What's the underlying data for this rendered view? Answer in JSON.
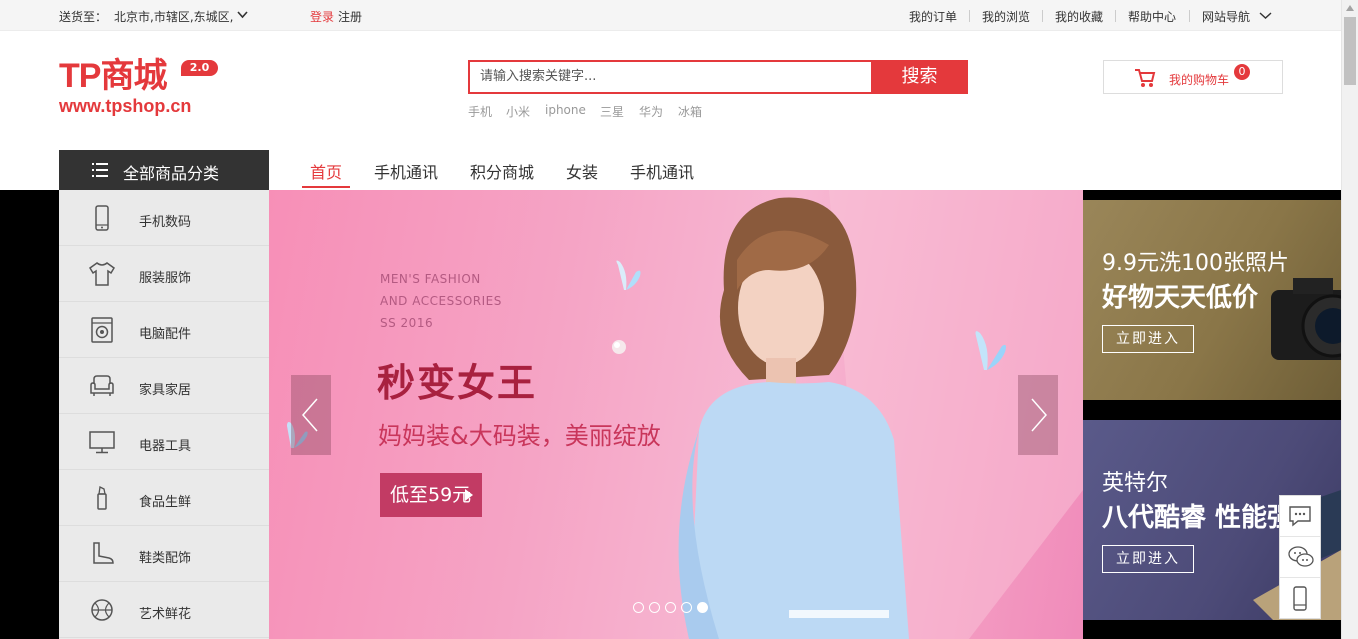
{
  "topbar": {
    "delivery_label": "送货至：",
    "location": "北京市,市辖区,东城区,",
    "login": "登录",
    "register": "注册",
    "links": [
      "我的订单",
      "我的浏览",
      "我的收藏",
      "帮助中心",
      "网站导航"
    ]
  },
  "header": {
    "logo_text": "TP商城",
    "logo_version": "2.0",
    "logo_url": "www.tpshop.cn",
    "search_placeholder": "请输入搜索关键字...",
    "search_button": "搜索",
    "hot_words": [
      "手机",
      "小米",
      "iphone",
      "三星",
      "华为",
      "冰箱"
    ],
    "cart_label": "我的购物车",
    "cart_count": "0"
  },
  "nav": {
    "all_categories": "全部商品分类",
    "items": [
      "首页",
      "手机通讯",
      "积分商城",
      "女装",
      "手机通讯"
    ],
    "active_index": 0
  },
  "categories": [
    {
      "label": "手机数码",
      "icon": "phone-icon"
    },
    {
      "label": "服装服饰",
      "icon": "shirt-icon"
    },
    {
      "label": "电脑配件",
      "icon": "washer-icon"
    },
    {
      "label": "家具家居",
      "icon": "sofa-icon"
    },
    {
      "label": "电器工具",
      "icon": "monitor-icon"
    },
    {
      "label": "食品生鲜",
      "icon": "lipstick-icon"
    },
    {
      "label": "鞋类配饰",
      "icon": "boot-icon"
    },
    {
      "label": "艺术鲜花",
      "icon": "ball-icon"
    }
  ],
  "slide": {
    "en_lines": [
      "MEN'S FASHION",
      "AND ACCESSORIES",
      "SS 2016"
    ],
    "title": "秒变女王",
    "subtitle": "妈妈装&大码装，美丽绽放",
    "cta": "低至59元",
    "dot_count": 5,
    "active_dot": 4
  },
  "ads": [
    {
      "line1": "9.9元洗100张照片",
      "line2": "好物天天低价",
      "button": "立即进入",
      "color": "#8a7648"
    },
    {
      "line1": "英特尔",
      "line2": "八代酷睿 性能强劲",
      "button": "立即进入",
      "color": "#4d4b78"
    }
  ],
  "colors": {
    "brand": "#e4393c",
    "cta": "#c23b64"
  }
}
